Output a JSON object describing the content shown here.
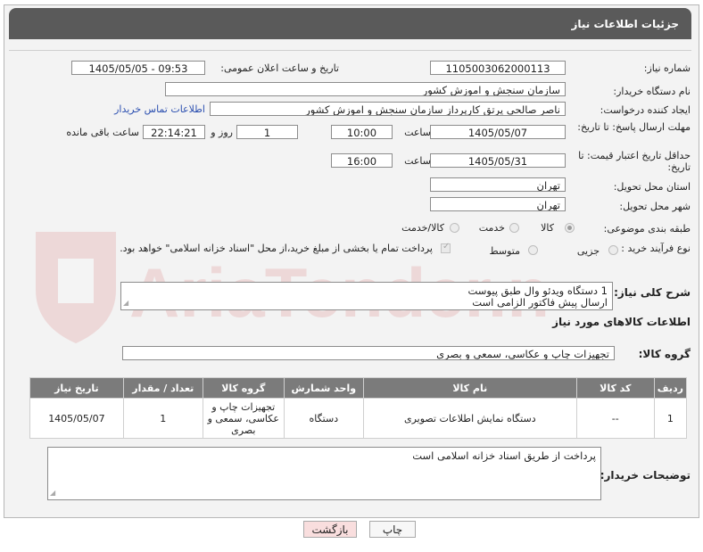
{
  "header": {
    "title": "جزئیات اطلاعات نیاز"
  },
  "labels": {
    "need_number": "شماره نیاز:",
    "announce_datetime": "تاریخ و ساعت اعلان عمومی:",
    "buyer_org": "نام دستگاه خریدار:",
    "requester": "ایجاد کننده درخواست:",
    "reply_deadline": "مهلت ارسال پاسخ: تا تاریخ:",
    "time": "ساعت",
    "day_and": "روز و",
    "remaining": "ساعت باقی مانده",
    "price_validity": "حداقل تاریخ اعتبار قیمت: تا تاریخ:",
    "province": "استان محل تحویل:",
    "city": "شهر محل تحویل:",
    "category": "طبقه بندی موضوعی:",
    "process": "نوع فرآیند خرید :",
    "general_desc": "شرح کلی نیاز:",
    "goods_info": "اطلاعات کالاهای مورد نیاز",
    "goods_group": "گروه کالا:",
    "buyer_notes": "توضیحات خریدار:"
  },
  "values": {
    "need_number": "1105003062000113",
    "announce_datetime": "1405/05/05 - 09:53",
    "buyer_org": "سازمان سنجش و اموزش کشور",
    "requester": "ناصر صالحی پرتق کارپرداز سازمان سنجش و اموزش کشور",
    "contact_link": "اطلاعات تماس خریدار",
    "reply_date": "1405/05/07",
    "reply_time": "10:00",
    "days": "1",
    "remaining_time": "22:14:21",
    "price_date": "1405/05/31",
    "price_time": "16:00",
    "province": "تهران",
    "city": "تهران",
    "category_options": [
      "کالا",
      "خدمت",
      "کالا/خدمت"
    ],
    "process_options": [
      "جزیی",
      "متوسط"
    ],
    "payment_note": "پرداخت تمام یا بخشی از مبلغ خرید،از محل \"اسناد خزانه اسلامی\" خواهد بود.",
    "general_desc_line1": "1 دستگاه ویدئو وال طبق پیوست",
    "general_desc_line2": "ارسال پیش فاکتور الزامی است",
    "goods_group": "تجهیزات چاپ و عکاسی، سمعی و بصری",
    "buyer_notes": "پرداخت از طریق اسناد خزانه اسلامی است"
  },
  "table": {
    "headers": [
      "ردیف",
      "کد کالا",
      "نام کالا",
      "واحد شمارش",
      "گروه کالا",
      "تعداد / مقدار",
      "تاریخ نیاز"
    ],
    "rows": [
      [
        "1",
        "--",
        "دستگاه نمایش اطلاعات تصویری",
        "دستگاه",
        "تجهیزات چاپ و عکاسی، سمعی و بصری",
        "1",
        "1405/05/07"
      ]
    ]
  },
  "buttons": {
    "print": "چاپ",
    "back": "بازگشت"
  },
  "watermark": {
    "text": "AriaTender.net"
  },
  "colors": {
    "header_bg": "#5a5a5a",
    "table_header_bg": "#7b7b7b",
    "link": "#2b4fb0",
    "back_btn_bg": "#f9dede",
    "watermark": "#c8282d"
  }
}
